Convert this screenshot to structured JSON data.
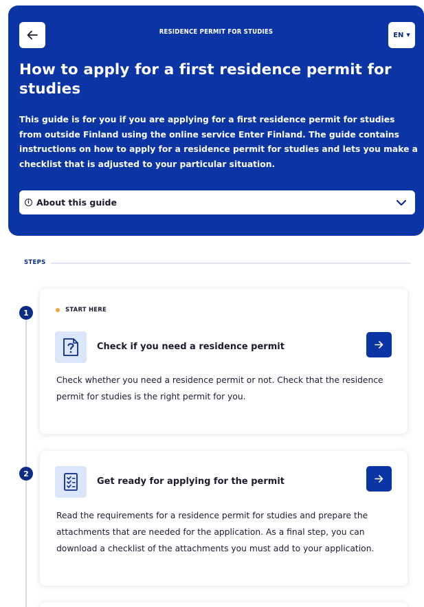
{
  "header": {
    "back_icon": "arrow-left-icon",
    "kicker": "RESIDENCE PERMIT FOR STUDIES",
    "language": "EN",
    "title": "How to apply for a first residence permit for studies",
    "description": "This guide is for you if you are applying for a first residence permit for studies from outside Finland using the online service Enter Finland. The guide contains instructions on how to apply for a residence permit for studies and lets you make a checklist that is adjusted to your particular situation.",
    "about_label": "About this guide"
  },
  "steps": {
    "label": "STEPS",
    "items": [
      {
        "number": "1",
        "badge": "START HERE",
        "icon": "question-document-icon",
        "title": "Check if you need a residence permit",
        "description": "Check whether you need a residence permit or not. Check that the residence permit for studies is the right permit for you."
      },
      {
        "number": "2",
        "badge": "",
        "icon": "checklist-icon",
        "title": "Get ready for applying for the permit",
        "description": "Read the requirements for a residence permit for studies and prepare the attachments that are needed for the application. As a final step, you can download a checklist of the attachments you must add to your application."
      }
    ]
  },
  "colors": {
    "brand_blue": "#0b35a4",
    "dark_navy": "#0b2a86",
    "badge_orange": "#f6a23a",
    "icon_bg": "#dbe6fb"
  }
}
